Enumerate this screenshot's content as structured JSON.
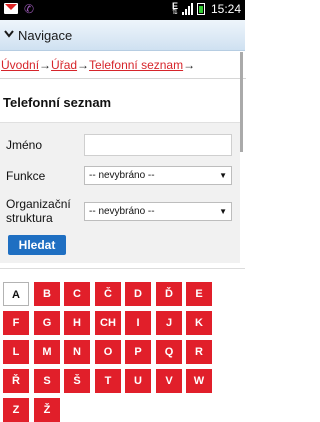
{
  "status_bar": {
    "time": "15:24",
    "network": "E",
    "icons": [
      "gmail-icon",
      "phone-icon",
      "data-arrows-icon",
      "signal-icon",
      "battery-icon"
    ]
  },
  "header": {
    "title": "Navigace",
    "icon": "chevron-down-icon"
  },
  "breadcrumb": {
    "items": [
      "Úvodní",
      "Úřad",
      "Telefonní seznam"
    ],
    "separator": "→"
  },
  "page": {
    "title": "Telefonní seznam"
  },
  "form": {
    "name_label": "Jméno",
    "name_value": "",
    "function_label": "Funkce",
    "function_value": "-- nevybráno --",
    "org_label_line1": "Organizační",
    "org_label_line2": "struktura",
    "org_value": "-- nevybráno --",
    "search_button": "Hledat"
  },
  "letters": {
    "active": "A",
    "items": [
      "A",
      "B",
      "C",
      "Č",
      "D",
      "Ď",
      "E",
      "F",
      "G",
      "H",
      "CH",
      "I",
      "J",
      "K",
      "L",
      "M",
      "N",
      "O",
      "P",
      "Q",
      "R",
      "Ř",
      "S",
      "Š",
      "T",
      "U",
      "V",
      "W",
      "Z",
      "Ž"
    ]
  },
  "colors": {
    "accent_red": "#e11f2a",
    "button_blue": "#1f6fc2",
    "header_bg": "#dce9f5"
  }
}
